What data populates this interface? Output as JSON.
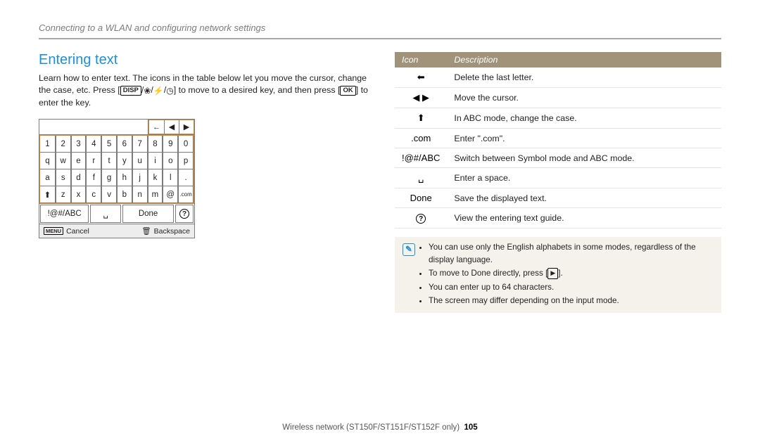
{
  "header": "Connecting to a WLAN and configuring network settings",
  "section_title": "Entering text",
  "intro": {
    "line1": "Learn how to enter text. The icons in the table below let you move the cursor, change the case, etc. Press [",
    "disp": "DISP",
    "slash1": "/",
    "macro_icon": "❀",
    "slash2": "/",
    "flash_icon": "⚡",
    "slash3": "/",
    "timer_icon": "◷",
    "line2": "] to move to a desired key, and then press [",
    "ok": "OK",
    "line3": "] to enter the key."
  },
  "keyboard": {
    "topArrows": [
      "←",
      "◀",
      "▶"
    ],
    "rows": [
      [
        "1",
        "2",
        "3",
        "4",
        "5",
        "6",
        "7",
        "8",
        "9",
        "0"
      ],
      [
        "q",
        "w",
        "e",
        "r",
        "t",
        "y",
        "u",
        "i",
        "o",
        "p"
      ],
      [
        "a",
        "s",
        "d",
        "f",
        "g",
        "h",
        "j",
        "k",
        "l",
        "."
      ],
      [
        "⬆",
        "z",
        "x",
        "c",
        "v",
        "b",
        "n",
        "m",
        "@",
        ".com"
      ]
    ],
    "bottom": {
      "sym": "!@#/ABC",
      "space": "␣",
      "done": "Done",
      "help": "?"
    },
    "footer": {
      "menuLabel": "MENU",
      "cancel": "Cancel",
      "trash": "🗑",
      "backspace": "Backspace"
    }
  },
  "table": {
    "head_icon": "Icon",
    "head_desc": "Description",
    "rows": [
      {
        "icon": "backspace",
        "desc": "Delete the last letter."
      },
      {
        "icon": "lr-arrows",
        "desc": "Move the cursor."
      },
      {
        "icon": "shift",
        "desc": "In ABC mode, change the case."
      },
      {
        "icon": "com",
        "desc": "Enter \".com\"."
      },
      {
        "icon": "symabc",
        "desc": "Switch between Symbol mode and ABC mode."
      },
      {
        "icon": "space",
        "desc": "Enter a space."
      },
      {
        "icon": "done",
        "desc": "Save the displayed text."
      },
      {
        "icon": "help",
        "desc": "View the entering text guide."
      }
    ]
  },
  "notes": {
    "n1": "You can use only the English alphabets in some modes, regardless of the display language.",
    "n2a": "To move to ",
    "n2_done": "Done",
    "n2b": " directly, press [",
    "n2_play": "▶",
    "n2c": "].",
    "n3": "You can enter up to 64 characters.",
    "n4": "The screen may differ depending on the input mode."
  },
  "footer": {
    "text": "Wireless network  (ST150F/ST151F/ST152F only)",
    "page": "105"
  }
}
